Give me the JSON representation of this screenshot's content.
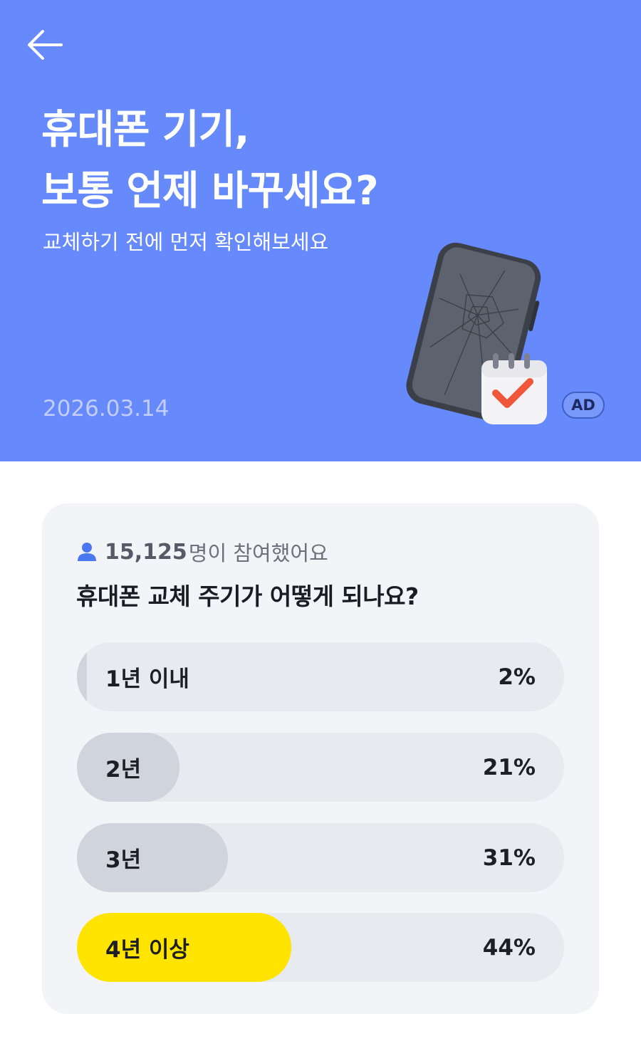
{
  "header": {
    "back_icon": "arrow-left-icon",
    "title_line1": "휴대폰 기기,",
    "title_line2": "보통 언제 바꾸세요?",
    "subtitle": "교체하기 전에 먼저 확인해보세요",
    "date": "2026.03.14",
    "ad_label": "AD",
    "background_color": "#6689fb"
  },
  "poll": {
    "participant_icon": "person-icon",
    "participant_count": "15,125",
    "participant_suffix": "명이 참여했어요",
    "question": "휴대폰 교체 주기가 어떻게 되나요?",
    "options": [
      {
        "label": "1년 이내",
        "percent_text": "2%",
        "percent": 2,
        "winner": false
      },
      {
        "label": "2년",
        "percent_text": "21%",
        "percent": 21,
        "winner": false
      },
      {
        "label": "3년",
        "percent_text": "31%",
        "percent": 31,
        "winner": false
      },
      {
        "label": "4년 이상",
        "percent_text": "44%",
        "percent": 44,
        "winner": true
      }
    ],
    "winner_color": "#ffe400",
    "bar_fill_color": "#d0d4dc"
  }
}
